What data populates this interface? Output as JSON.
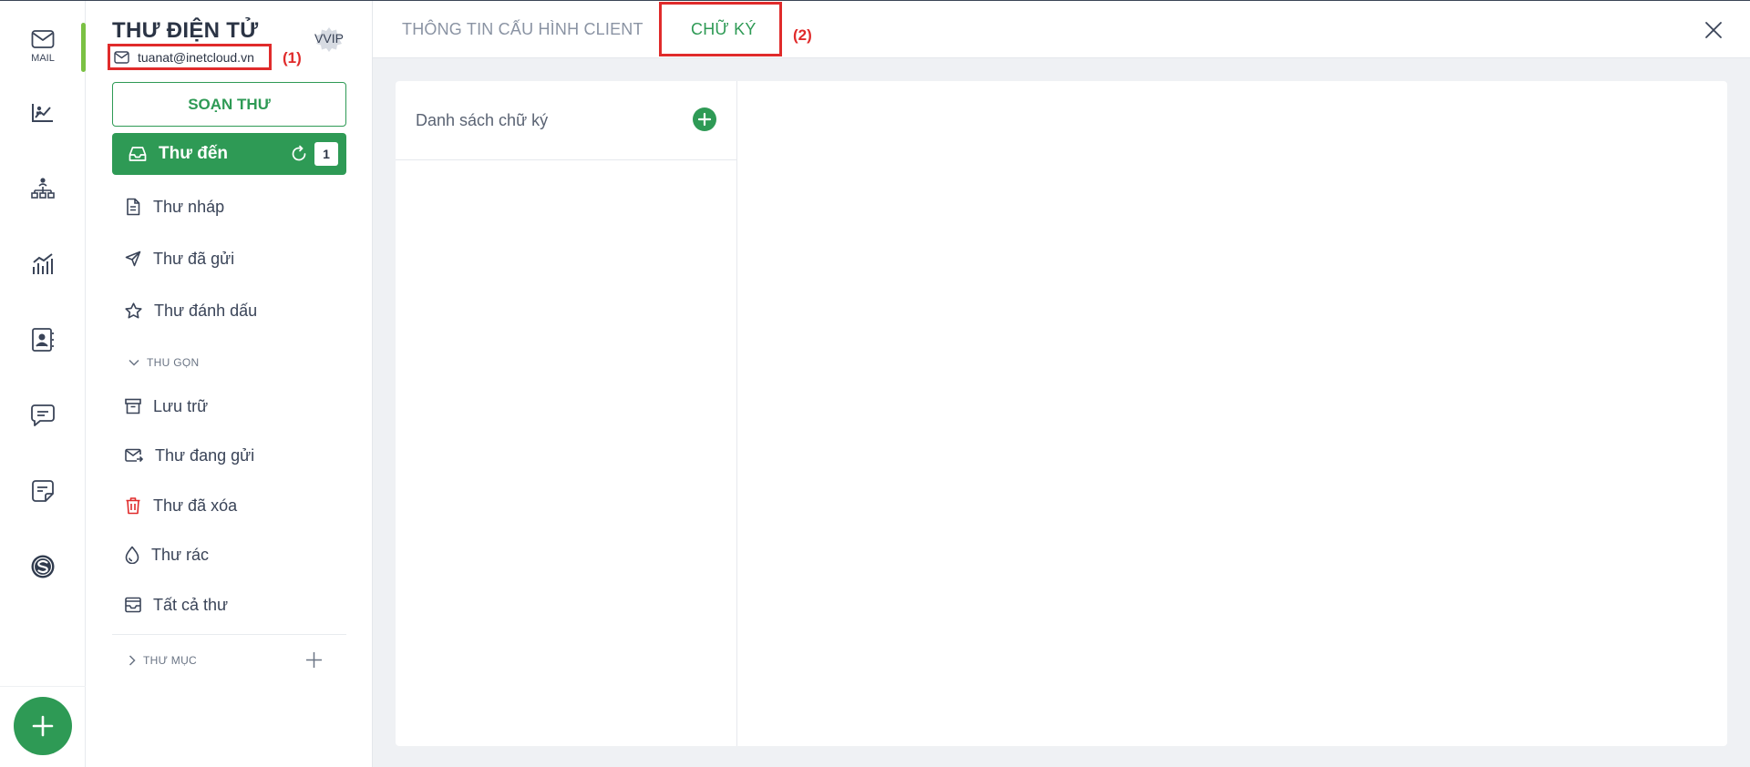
{
  "rail": {
    "items": [
      {
        "name": "mail",
        "label": "MAIL",
        "icon": "mail-icon"
      },
      {
        "name": "analytics",
        "label": "",
        "icon": "chart-line-icon"
      },
      {
        "name": "org",
        "label": "",
        "icon": "hierarchy-icon"
      },
      {
        "name": "reports",
        "label": "",
        "icon": "bar-chart-icon"
      },
      {
        "name": "contacts",
        "label": "",
        "icon": "contact-book-icon"
      },
      {
        "name": "chat",
        "label": "",
        "icon": "chat-icon"
      },
      {
        "name": "notes",
        "label": "",
        "icon": "note-icon"
      },
      {
        "name": "brand",
        "label": "",
        "icon": "s-logo-icon"
      }
    ],
    "add_icon": "plus-icon",
    "accent": "#7ac143"
  },
  "sidebar": {
    "title": "THƯ ĐIỆN TỬ",
    "badge": "VVIP",
    "email": "tuanat@inetcloud.vn",
    "annotation_1": "(1)",
    "compose_label": "SOẠN THƯ",
    "inbox": {
      "label": "Thư đến",
      "count": "1"
    },
    "folders": [
      {
        "label": "Thư nháp",
        "icon": "draft-icon"
      },
      {
        "label": "Thư đã gửi",
        "icon": "send-icon"
      },
      {
        "label": "Thư đánh dấu",
        "icon": "star-icon"
      }
    ],
    "collapse_label": "THU GỌN",
    "more_folders": [
      {
        "label": "Lưu trữ",
        "icon": "archive-icon"
      },
      {
        "label": "Thư đang gửi",
        "icon": "outbox-icon"
      },
      {
        "label": "Thư đã xóa",
        "icon": "trash-icon"
      },
      {
        "label": "Thư rác",
        "icon": "spam-icon"
      },
      {
        "label": "Tất cả thư",
        "icon": "all-mail-icon"
      }
    ],
    "custom_folders_label": "THƯ MỤC",
    "brand_color": "#2e9a55",
    "danger_color": "#e02b2b"
  },
  "main": {
    "tabs": [
      {
        "label": "THÔNG TIN CẤU HÌNH CLIENT"
      },
      {
        "label": "CHỮ KÝ"
      }
    ],
    "annotation_2": "(2)",
    "signature_list_title": "Danh sách chữ ký"
  }
}
